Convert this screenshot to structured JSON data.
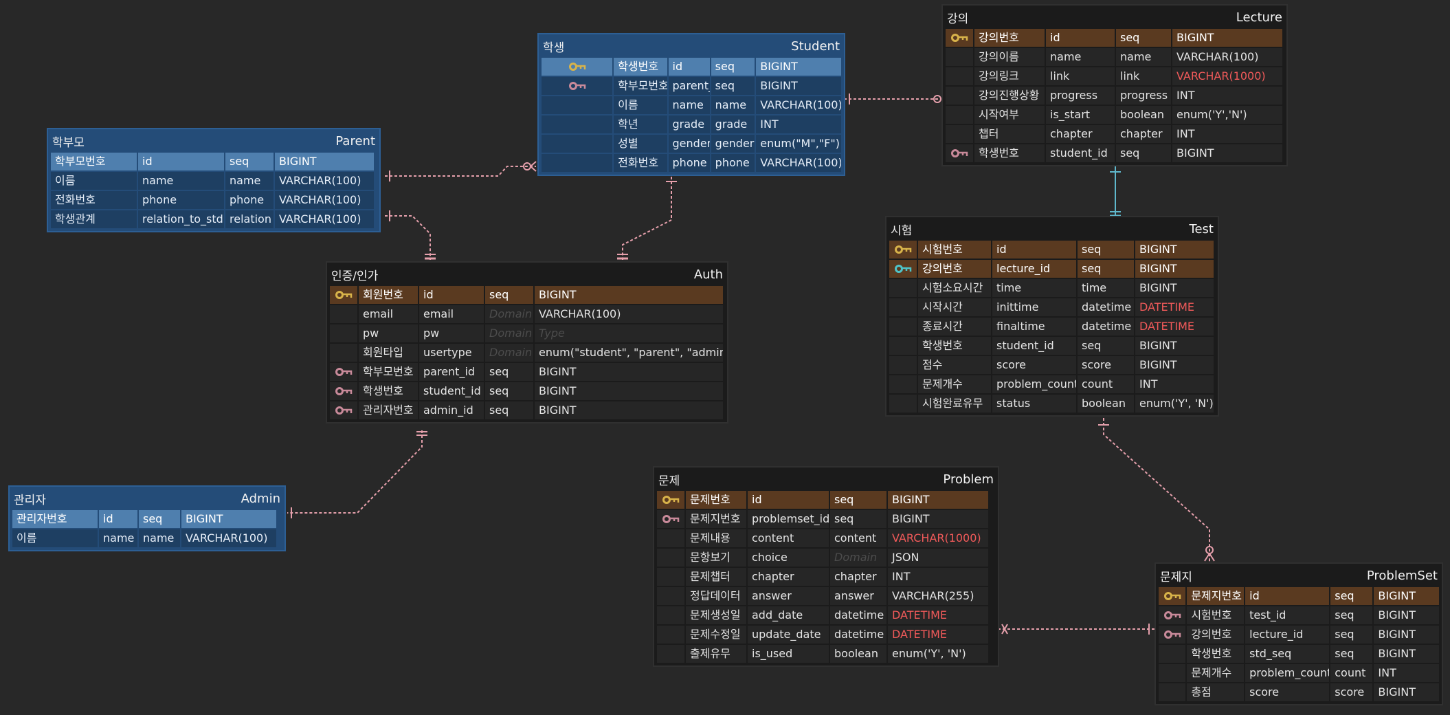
{
  "colors": {
    "background": "#282828",
    "blue_header_entity": "#244c78",
    "pk_key": "#d8b34a",
    "fk_key": "#c98a9a",
    "teal_key": "#4fc3c8",
    "relation_line": "#e6a0ac",
    "relation_line_teal": "#5fb8cc",
    "red_type": "#f15a5a"
  },
  "entities": {
    "parent": {
      "kr": "학부모",
      "en": "Parent",
      "rows": [
        {
          "key": "pk",
          "c": [
            "학부모번호",
            "id",
            "seq",
            "BIGINT"
          ]
        },
        {
          "key": "",
          "c": [
            "이름",
            "name",
            "name",
            "VARCHAR(100)"
          ]
        },
        {
          "key": "",
          "c": [
            "전화번호",
            "phone",
            "phone",
            "VARCHAR(100)"
          ]
        },
        {
          "key": "",
          "c": [
            "학생관계",
            "relation_to_std",
            "relation",
            "VARCHAR(100)"
          ]
        }
      ]
    },
    "student": {
      "kr": "학생",
      "en": "Student",
      "rows": [
        {
          "key": "pk",
          "c": [
            "학생번호",
            "id",
            "seq",
            "BIGINT"
          ]
        },
        {
          "key": "fk",
          "c": [
            "학부모번호",
            "parent_id",
            "seq",
            "BIGINT"
          ]
        },
        {
          "key": "",
          "c": [
            "이름",
            "name",
            "name",
            "VARCHAR(100)"
          ]
        },
        {
          "key": "",
          "c": [
            "학년",
            "grade",
            "grade",
            "INT"
          ]
        },
        {
          "key": "",
          "c": [
            "성별",
            "gender",
            "gender",
            "enum(\"M\",\"F\")"
          ]
        },
        {
          "key": "",
          "c": [
            "전화번호",
            "phone",
            "phone",
            "VARCHAR(100)"
          ]
        }
      ]
    },
    "lecture": {
      "kr": "강의",
      "en": "Lecture",
      "rows": [
        {
          "key": "pk",
          "c": [
            "강의번호",
            "id",
            "seq",
            "BIGINT"
          ]
        },
        {
          "key": "",
          "c": [
            "강의이름",
            "name",
            "name",
            "VARCHAR(100)"
          ]
        },
        {
          "key": "",
          "c": [
            "강의링크",
            "link",
            "link",
            "VARCHAR(1000)"
          ]
        },
        {
          "key": "",
          "c": [
            "강의진행상황",
            "progress",
            "progress",
            "INT"
          ]
        },
        {
          "key": "",
          "c": [
            "시작여부",
            "is_start",
            "boolean",
            "enum('Y','N')"
          ]
        },
        {
          "key": "",
          "c": [
            "챕터",
            "chapter",
            "chapter",
            "INT"
          ]
        },
        {
          "key": "fk",
          "c": [
            "학생번호",
            "student_id",
            "seq",
            "BIGINT"
          ]
        }
      ]
    },
    "auth": {
      "kr": "인증/인가",
      "en": "Auth",
      "rows": [
        {
          "key": "pk",
          "c": [
            "회원번호",
            "id",
            "seq",
            "BIGINT"
          ]
        },
        {
          "key": "",
          "c": [
            "email",
            "email",
            "Domain",
            "VARCHAR(100)"
          ]
        },
        {
          "key": "",
          "c": [
            "pw",
            "pw",
            "Domain",
            "Type"
          ]
        },
        {
          "key": "",
          "c": [
            "회원타입",
            "usertype",
            "Domain",
            "enum(\"student\", \"parent\", \"admin\")"
          ]
        },
        {
          "key": "fk",
          "c": [
            "학부모번호",
            "parent_id",
            "seq",
            "BIGINT"
          ]
        },
        {
          "key": "fk",
          "c": [
            "학생번호",
            "student_id",
            "seq",
            "BIGINT"
          ]
        },
        {
          "key": "fk",
          "c": [
            "관리자번호",
            "admin_id",
            "seq",
            "BIGINT"
          ]
        }
      ]
    },
    "test": {
      "kr": "시험",
      "en": "Test",
      "rows": [
        {
          "key": "pk",
          "c": [
            "시험번호",
            "id",
            "seq",
            "BIGINT"
          ]
        },
        {
          "key": "teal",
          "c": [
            "강의번호",
            "lecture_id",
            "seq",
            "BIGINT"
          ]
        },
        {
          "key": "",
          "c": [
            "시험소요시간",
            "time",
            "time",
            "BIGINT"
          ]
        },
        {
          "key": "",
          "c": [
            "시작시간",
            "inittime",
            "datetime",
            "DATETIME"
          ]
        },
        {
          "key": "",
          "c": [
            "종료시간",
            "finaltime",
            "datetime",
            "DATETIME"
          ]
        },
        {
          "key": "",
          "c": [
            "학생번호",
            "student_id",
            "seq",
            "BIGINT"
          ]
        },
        {
          "key": "",
          "c": [
            "점수",
            "score",
            "score",
            "BIGINT"
          ]
        },
        {
          "key": "",
          "c": [
            "문제개수",
            "problem_count",
            "count",
            "INT"
          ]
        },
        {
          "key": "",
          "c": [
            "시험완료유무",
            "status",
            "boolean",
            "enum('Y', 'N')"
          ]
        }
      ]
    },
    "admin": {
      "kr": "관리자",
      "en": "Admin",
      "rows": [
        {
          "key": "pk",
          "c": [
            "관리자번호",
            "id",
            "seq",
            "BIGINT"
          ]
        },
        {
          "key": "",
          "c": [
            "이름",
            "name",
            "name",
            "VARCHAR(100)"
          ]
        }
      ]
    },
    "problem": {
      "kr": "문제",
      "en": "Problem",
      "rows": [
        {
          "key": "pk",
          "c": [
            "문제번호",
            "id",
            "seq",
            "BIGINT"
          ]
        },
        {
          "key": "fk",
          "c": [
            "문제지번호",
            "problemset_id",
            "seq",
            "BIGINT"
          ]
        },
        {
          "key": "",
          "c": [
            "문제내용",
            "content",
            "content",
            "VARCHAR(1000)"
          ]
        },
        {
          "key": "",
          "c": [
            "문항보기",
            "choice",
            "Domain",
            "JSON"
          ]
        },
        {
          "key": "",
          "c": [
            "문제챕터",
            "chapter",
            "chapter",
            "INT"
          ]
        },
        {
          "key": "",
          "c": [
            "정답데이터",
            "answer",
            "answer",
            "VARCHAR(255)"
          ]
        },
        {
          "key": "",
          "c": [
            "문제생성일",
            "add_date",
            "datetime",
            "DATETIME"
          ]
        },
        {
          "key": "",
          "c": [
            "문제수정일",
            "update_date",
            "datetime",
            "DATETIME"
          ]
        },
        {
          "key": "",
          "c": [
            "출제유무",
            "is_used",
            "boolean",
            "enum('Y', 'N')"
          ]
        }
      ]
    },
    "problemset": {
      "kr": "문제지",
      "en": "ProblemSet",
      "rows": [
        {
          "key": "pk",
          "c": [
            "문제지번호",
            "id",
            "seq",
            "BIGINT"
          ]
        },
        {
          "key": "fk",
          "c": [
            "시험번호",
            "test_id",
            "seq",
            "BIGINT"
          ]
        },
        {
          "key": "fk",
          "c": [
            "강의번호",
            "lecture_id",
            "seq",
            "BIGINT"
          ]
        },
        {
          "key": "",
          "c": [
            "학생번호",
            "std_seq",
            "seq",
            "BIGINT"
          ]
        },
        {
          "key": "",
          "c": [
            "문제개수",
            "problem_count",
            "count",
            "INT"
          ]
        },
        {
          "key": "",
          "c": [
            "총점",
            "score",
            "score",
            "BIGINT"
          ]
        }
      ]
    }
  }
}
